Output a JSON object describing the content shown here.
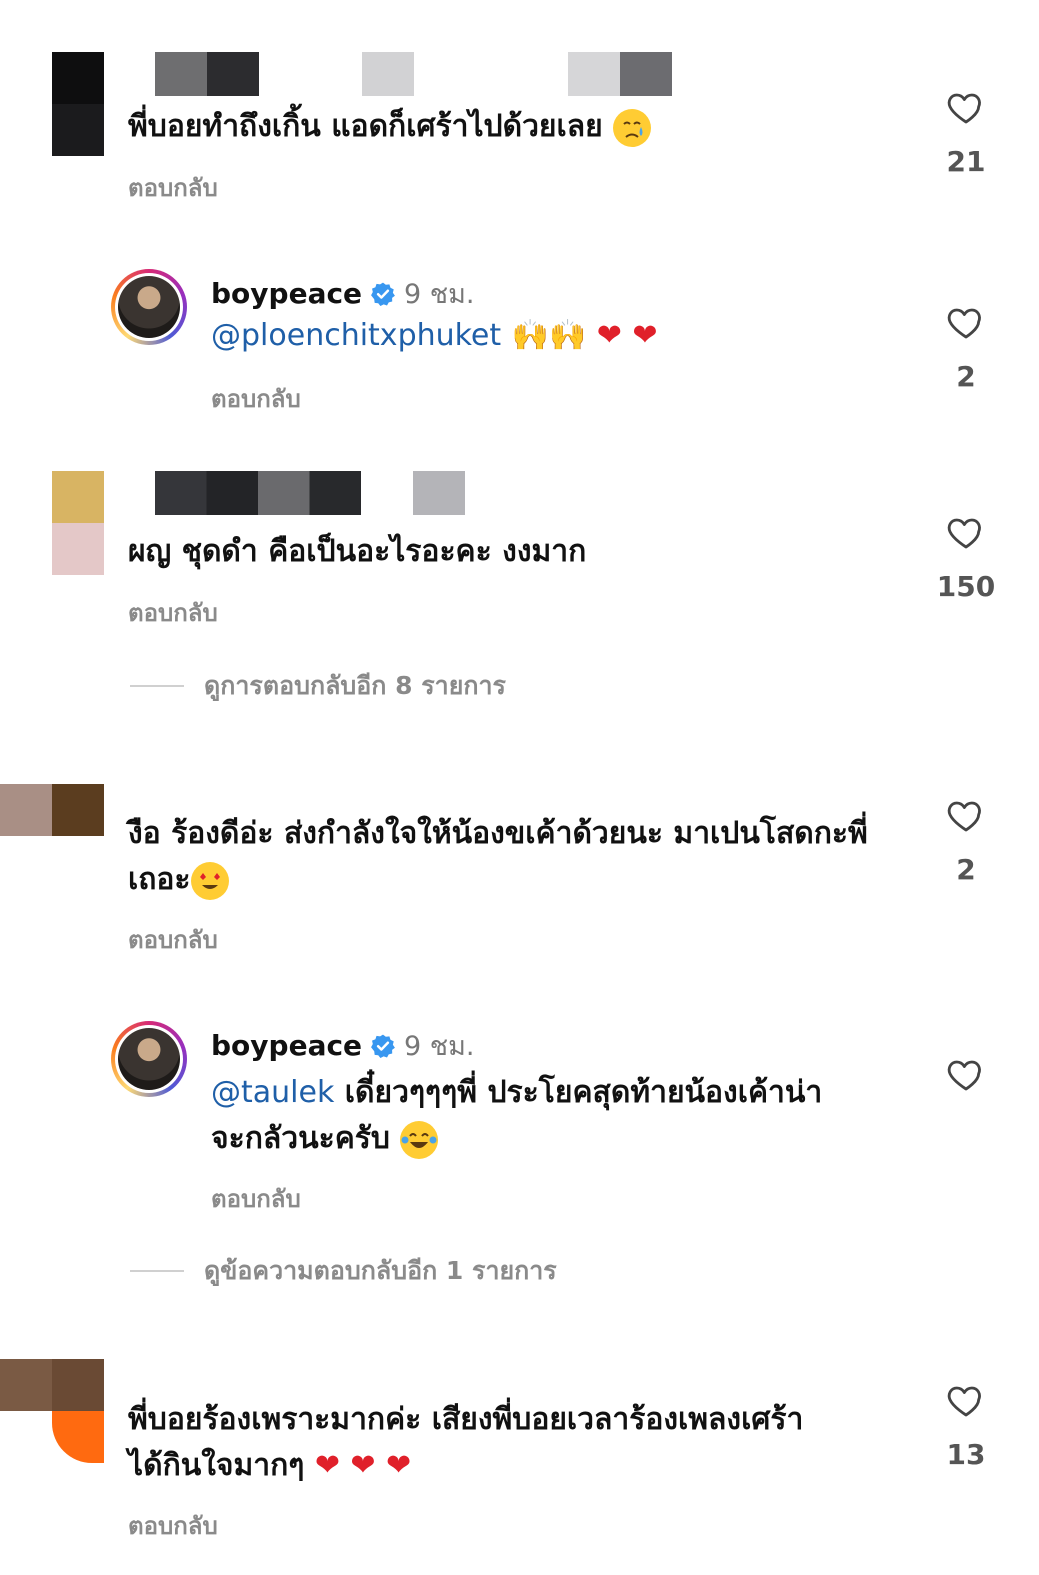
{
  "comments": [
    {
      "text": "พี่บอยทำถึงเกิ้น แอดก็เศร้าไปด้วยเลย",
      "reply_label": "ตอบกลับ",
      "likes": "21"
    },
    {
      "username": "boypeace",
      "time": "9 ชม.",
      "mention": "@ploenchitxphuket",
      "reply_label": "ตอบกลับ",
      "likes": "2"
    },
    {
      "text": "ผญ ชุดดำ คือเป็นอะไรอะคะ งงมาก",
      "reply_label": "ตอบกลับ",
      "likes": "150",
      "view_more": "ดูการตอบกลับอีก 8 รายการ"
    },
    {
      "text": "งือ ร้องดีอ่ะ ส่งกำลังใจให้น้องขเค้าด้วยนะ มาเปนโสดกะพี่\nเถอะ",
      "reply_label": "ตอบกลับ",
      "likes": "2"
    },
    {
      "username": "boypeace",
      "time": "9 ชม.",
      "mention": "@taulek",
      "text": "เดี๋ยวๆๆๆพี่ ประโยคสุดท้ายน้องเค้าน่า\nจะกลัวนะครับ",
      "reply_label": "ตอบกลับ",
      "view_more": "ดูข้อความตอบกลับอีก 1 รายการ"
    },
    {
      "text": "พี่บอยร้องเพราะมากค่ะ เสียงพี่บอยเวลาร้องเพลงเศร้า\nได้กินใจมากๆ",
      "reply_label": "ตอบกลับ",
      "likes": "13"
    }
  ],
  "icons": {
    "like": "heart-outline-icon",
    "verified": "verified-badge-icon",
    "crying_face": "crying-face-emoji",
    "raised_hands": "raised-hands-emoji",
    "red_heart": "red-heart-emoji",
    "heart_eyes": "heart-eyes-emoji",
    "laughing": "tears-of-joy-emoji"
  },
  "colors": {
    "mention": "#1f5fa8",
    "verified": "#3897f0",
    "secondary_text": "#8a8a8a"
  }
}
